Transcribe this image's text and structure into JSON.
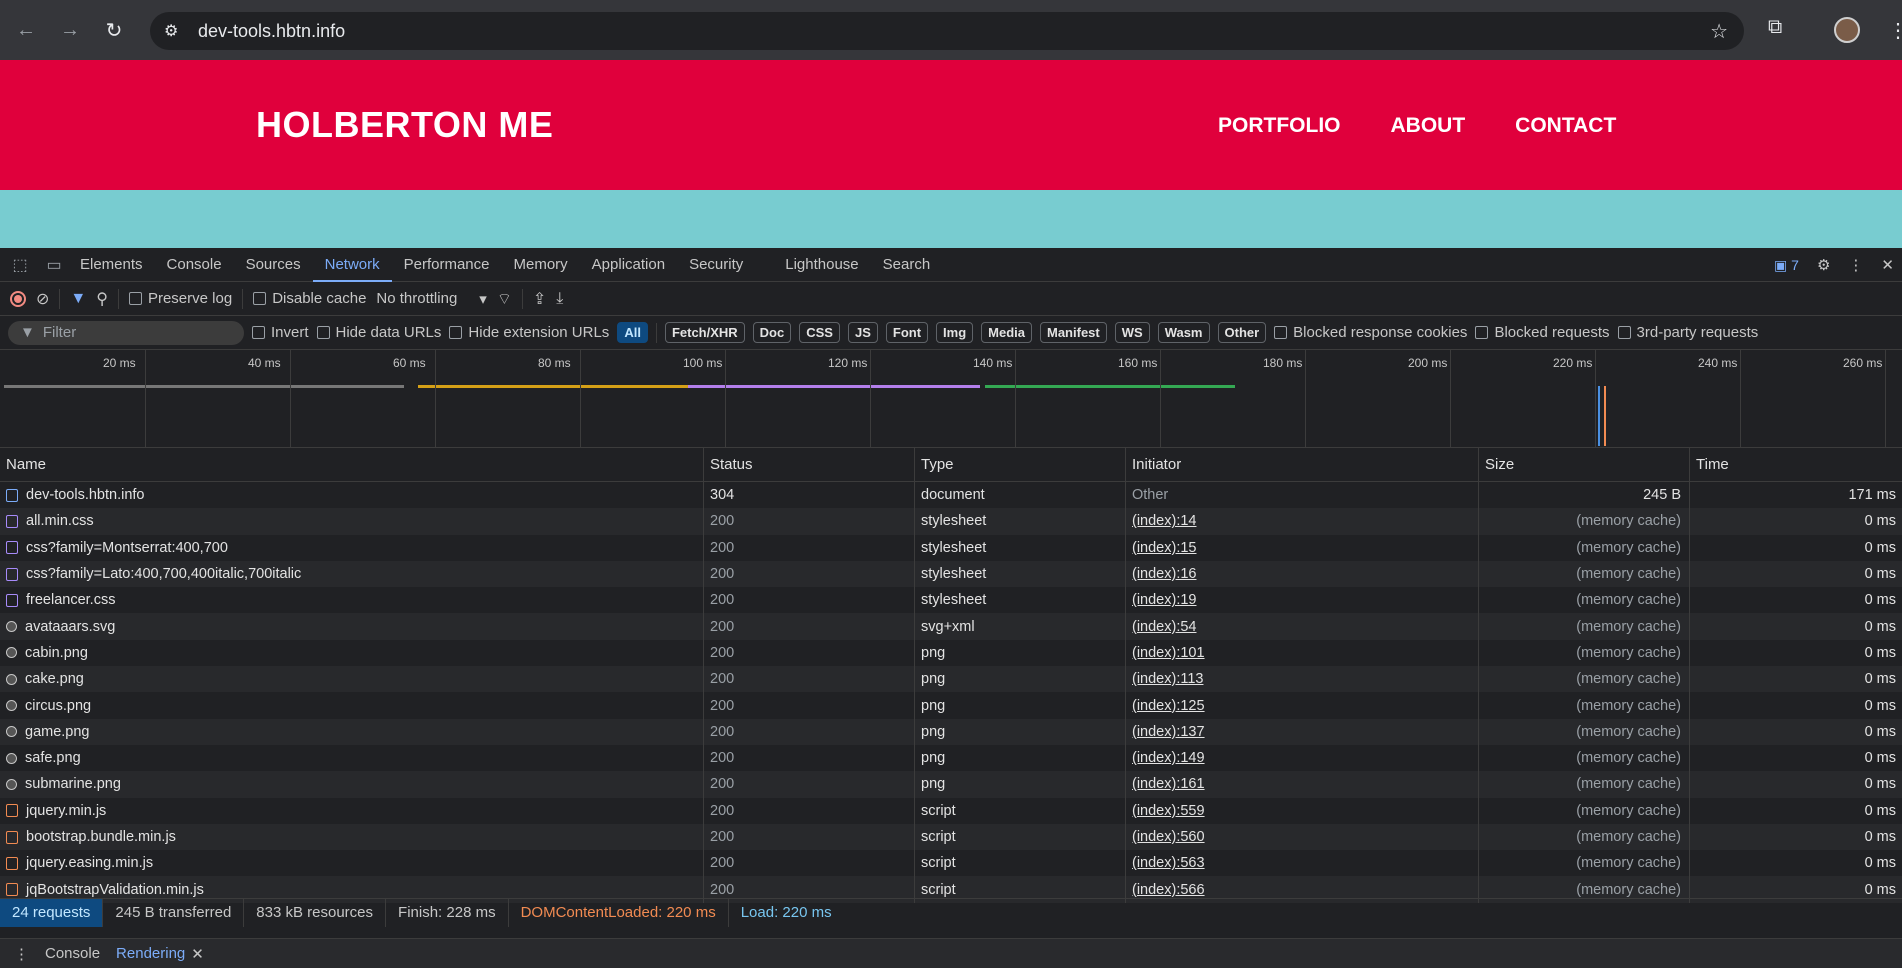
{
  "browser": {
    "url": "dev-tools.hbtn.info"
  },
  "site": {
    "title": "HOLBERTON ME",
    "nav": [
      "PORTFOLIO",
      "ABOUT",
      "CONTACT"
    ],
    "header_color": "#e0003c",
    "band_color": "#78ccd0"
  },
  "devtools": {
    "tabs": [
      "Elements",
      "Console",
      "Sources",
      "Network",
      "Performance",
      "Memory",
      "Application",
      "Security",
      "Lighthouse",
      "Search"
    ],
    "active_tab": "Network",
    "issues_count": "7",
    "toolbar": {
      "preserve_log": "Preserve log",
      "disable_cache": "Disable cache",
      "throttling": "No throttling"
    },
    "filter": {
      "placeholder": "Filter",
      "invert": "Invert",
      "hide_data_urls": "Hide data URLs",
      "hide_extension_urls": "Hide extension URLs",
      "types": [
        "All",
        "Fetch/XHR",
        "Doc",
        "CSS",
        "JS",
        "Font",
        "Img",
        "Media",
        "Manifest",
        "WS",
        "Wasm",
        "Other"
      ],
      "active_type": "All",
      "blocked_cookies": "Blocked response cookies",
      "blocked_requests": "Blocked requests",
      "third_party": "3rd-party requests"
    },
    "timeline_ticks": [
      "20 ms",
      "40 ms",
      "60 ms",
      "80 ms",
      "100 ms",
      "120 ms",
      "140 ms",
      "160 ms",
      "180 ms",
      "200 ms",
      "220 ms",
      "240 ms",
      "260 ms"
    ],
    "columns": {
      "name": "Name",
      "status": "Status",
      "type": "Type",
      "initiator": "Initiator",
      "size": "Size",
      "time": "Time"
    },
    "requests": [
      {
        "name": "dev-tools.hbtn.info",
        "status": "304",
        "type": "document",
        "initiator": "Other",
        "size": "245 B",
        "time": "171 ms",
        "icon": "doc"
      },
      {
        "name": "all.min.css",
        "status": "200",
        "type": "stylesheet",
        "initiator": "(index):14",
        "size": "(memory cache)",
        "time": "0 ms",
        "icon": "css"
      },
      {
        "name": "css?family=Montserrat:400,700",
        "status": "200",
        "type": "stylesheet",
        "initiator": "(index):15",
        "size": "(memory cache)",
        "time": "0 ms",
        "icon": "css"
      },
      {
        "name": "css?family=Lato:400,700,400italic,700italic",
        "status": "200",
        "type": "stylesheet",
        "initiator": "(index):16",
        "size": "(memory cache)",
        "time": "0 ms",
        "icon": "css"
      },
      {
        "name": "freelancer.css",
        "status": "200",
        "type": "stylesheet",
        "initiator": "(index):19",
        "size": "(memory cache)",
        "time": "0 ms",
        "icon": "css"
      },
      {
        "name": "avataaars.svg",
        "status": "200",
        "type": "svg+xml",
        "initiator": "(index):54",
        "size": "(memory cache)",
        "time": "0 ms",
        "icon": "img"
      },
      {
        "name": "cabin.png",
        "status": "200",
        "type": "png",
        "initiator": "(index):101",
        "size": "(memory cache)",
        "time": "0 ms",
        "icon": "img"
      },
      {
        "name": "cake.png",
        "status": "200",
        "type": "png",
        "initiator": "(index):113",
        "size": "(memory cache)",
        "time": "0 ms",
        "icon": "img"
      },
      {
        "name": "circus.png",
        "status": "200",
        "type": "png",
        "initiator": "(index):125",
        "size": "(memory cache)",
        "time": "0 ms",
        "icon": "img"
      },
      {
        "name": "game.png",
        "status": "200",
        "type": "png",
        "initiator": "(index):137",
        "size": "(memory cache)",
        "time": "0 ms",
        "icon": "img"
      },
      {
        "name": "safe.png",
        "status": "200",
        "type": "png",
        "initiator": "(index):149",
        "size": "(memory cache)",
        "time": "0 ms",
        "icon": "img"
      },
      {
        "name": "submarine.png",
        "status": "200",
        "type": "png",
        "initiator": "(index):161",
        "size": "(memory cache)",
        "time": "0 ms",
        "icon": "img"
      },
      {
        "name": "jquery.min.js",
        "status": "200",
        "type": "script",
        "initiator": "(index):559",
        "size": "(memory cache)",
        "time": "0 ms",
        "icon": "js"
      },
      {
        "name": "bootstrap.bundle.min.js",
        "status": "200",
        "type": "script",
        "initiator": "(index):560",
        "size": "(memory cache)",
        "time": "0 ms",
        "icon": "js"
      },
      {
        "name": "jquery.easing.min.js",
        "status": "200",
        "type": "script",
        "initiator": "(index):563",
        "size": "(memory cache)",
        "time": "0 ms",
        "icon": "js"
      },
      {
        "name": "jqBootstrapValidation.min.js",
        "status": "200",
        "type": "script",
        "initiator": "(index):566",
        "size": "(memory cache)",
        "time": "0 ms",
        "icon": "js"
      }
    ],
    "summary": {
      "requests": "24 requests",
      "transferred": "245 B transferred",
      "resources": "833 kB resources",
      "finish": "Finish: 228 ms",
      "dcl": "DOMContentLoaded: 220 ms",
      "load": "Load: 220 ms"
    },
    "drawer": {
      "tabs": [
        "Console",
        "Rendering"
      ],
      "active": "Rendering"
    }
  }
}
